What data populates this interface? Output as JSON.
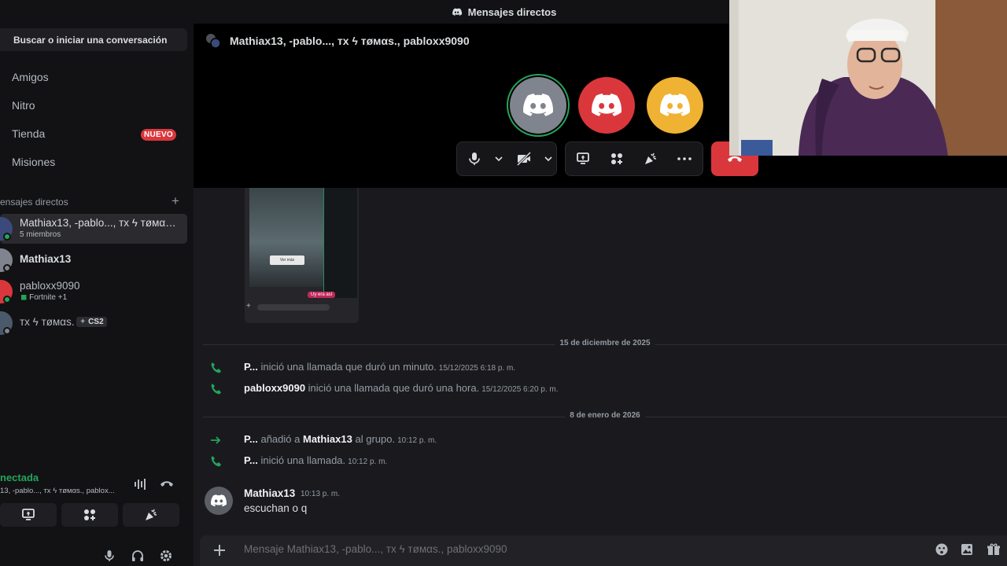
{
  "topbar": {
    "title": "Mensajes directos"
  },
  "sidebar": {
    "search_label": "Buscar o iniciar una conversación",
    "nav": [
      {
        "label": "Amigos",
        "icon": "friends-icon"
      },
      {
        "label": "Nitro",
        "icon": "nitro-icon"
      },
      {
        "label": "Tienda",
        "icon": "shop-icon",
        "badge": "NUEVO"
      },
      {
        "label": "Misiones",
        "icon": "quests-icon"
      }
    ],
    "dm_header": "ensajes directos",
    "dm_add": "+",
    "dms": [
      {
        "name": "Mathiax13, -pablo..., тх ϟ тøмαѕ., pabloxx9090",
        "sub": "5 miembros",
        "status": "online"
      },
      {
        "name": "Mathiax13",
        "sub": "",
        "status": "offline"
      },
      {
        "name": "pabloxx9090",
        "sub": "Fortnite +1",
        "status": "online"
      },
      {
        "name": "тх ϟ тøмαѕ.",
        "tag": "CS2",
        "status": "offline"
      }
    ],
    "voice": {
      "status": "nectada",
      "channel": "13, -pablo..., тх ϟ тøмαѕ., pablox..."
    }
  },
  "call": {
    "title": "Mathiax13, -pablo..., тх ϟ тøмαѕ., pabloxx9090",
    "participant_colors": [
      "#80848e",
      "#da373c",
      "#f0b232"
    ],
    "speaking_color": "#23a55a"
  },
  "chat": {
    "days": [
      "15 de diciembre de 2025",
      "8 de enero de 2026"
    ],
    "system_messages": [
      {
        "icon": "phone-icon",
        "actor": "P...",
        "text": "inició una llamada que duró un minuto.",
        "time": "15/12/2025 6:18 p. m."
      },
      {
        "icon": "phone-icon",
        "actor": "pabloxx9090",
        "text": "inició una llamada que duró una hora.",
        "time": "15/12/2025 6:20 p. m."
      },
      {
        "icon": "arrow-right-icon",
        "actor": "P...",
        "text_before": "añadió a",
        "target": "Mathiax13",
        "text_after": "al grupo.",
        "time": "10:12 p. m."
      },
      {
        "icon": "phone-icon",
        "actor": "P...",
        "text": "inició una llamada.",
        "time": "10:12 p. m."
      }
    ],
    "message": {
      "author": "Mathiax13",
      "time": "10:13 p. m.",
      "text": "escuchan o q"
    },
    "attachment_caption": "Uy era así",
    "attachment_button": "Ver más"
  },
  "composer": {
    "placeholder": "Mensaje Mathiax13, -pablo..., тх ϟ тøмαѕ., pabloxx9090"
  },
  "colors": {
    "green": "#23a55a",
    "red": "#da373c",
    "yellow": "#f0b232",
    "bg": "#1a1a1e"
  }
}
